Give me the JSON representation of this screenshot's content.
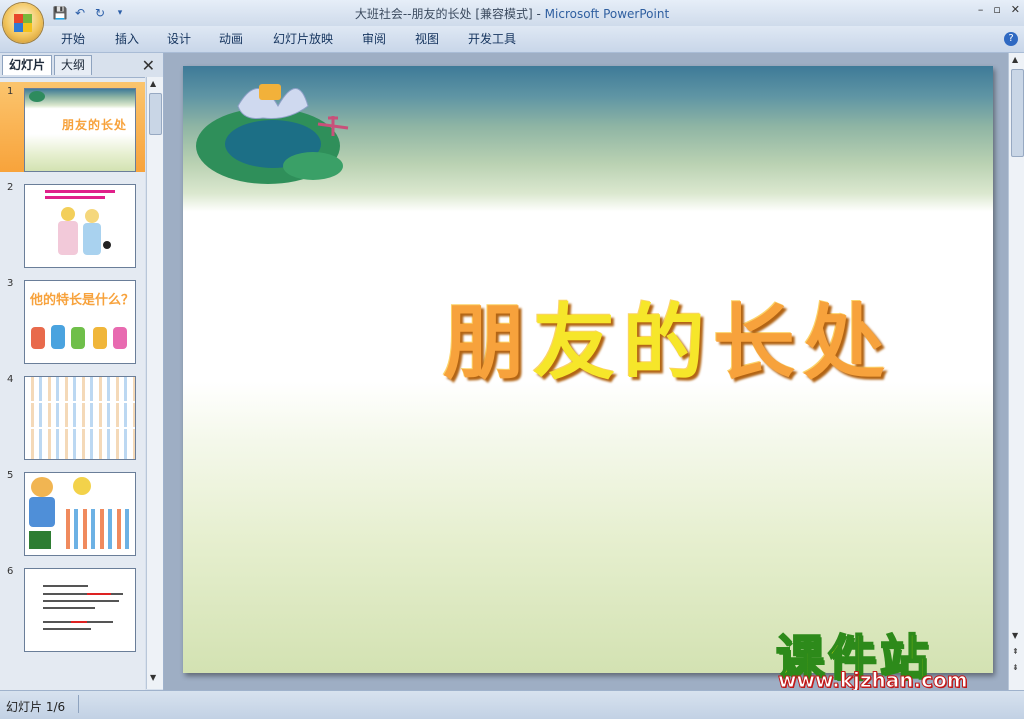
{
  "window": {
    "doc_title": "大班社会--朋友的长处 [兼容模式]",
    "separator": " - ",
    "app_name": "Microsoft PowerPoint",
    "controls": [
      "–",
      "▫",
      "✕"
    ]
  },
  "quick_access": [
    "save-icon",
    "undo-icon",
    "redo-icon",
    "customize-icon"
  ],
  "ribbon": {
    "tabs": [
      "开始",
      "插入",
      "设计",
      "动画",
      "幻灯片放映",
      "审阅",
      "视图",
      "开发工具"
    ],
    "help": "?"
  },
  "panel": {
    "tab_slides": "幻灯片",
    "tab_outline": "大纲",
    "close": "✕",
    "thumbnails": [
      {
        "num": "1",
        "title": "朋友的长处",
        "selected": true
      },
      {
        "num": "2",
        "title": ""
      },
      {
        "num": "3",
        "title": "他的特长是什么？"
      },
      {
        "num": "4",
        "title": ""
      },
      {
        "num": "5",
        "title": ""
      },
      {
        "num": "6",
        "title": ""
      }
    ]
  },
  "slide": {
    "title_parts": [
      "朋",
      "友",
      "的",
      "长",
      "处"
    ]
  },
  "watermark": {
    "cn": "课件站",
    "url": "www.kjzhan.com"
  },
  "status": {
    "slide_indicator": "幻灯片 1/6"
  },
  "colors": {
    "title_orange": "#f7a23c",
    "title_yellow": "#f6e62a",
    "selection": "#f8a33b",
    "ribbon": "#dfe8f4"
  }
}
